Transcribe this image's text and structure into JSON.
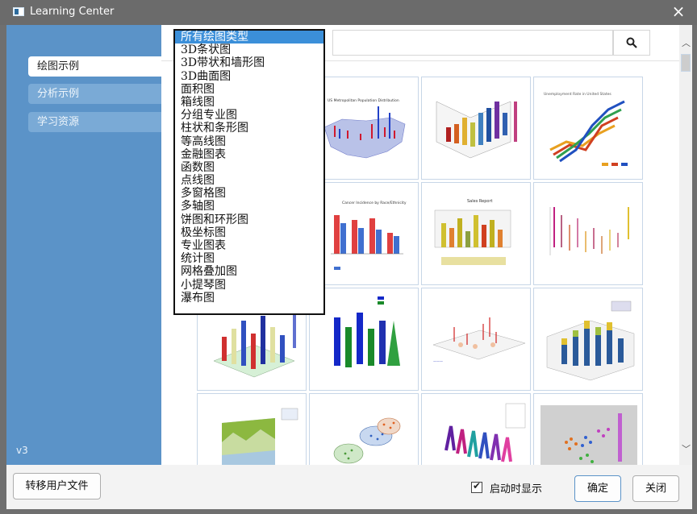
{
  "window": {
    "title": "Learning Center",
    "close_icon": "×"
  },
  "sidebar": {
    "items": [
      {
        "label": "绘图示例",
        "active": true
      },
      {
        "label": "分析示例",
        "active": false
      },
      {
        "label": "学习资源",
        "active": false
      }
    ],
    "version": "v3"
  },
  "search": {
    "value": "",
    "placeholder": ""
  },
  "dropdown": {
    "selected": "所有绘图类型",
    "options": [
      "所有绘图类型",
      "3D条状图",
      "3D带状和墙形图",
      "3D曲面图",
      "面积图",
      "箱线图",
      "分组专业图",
      "柱状和条形图",
      "等高线图",
      "金融图表",
      "函数图",
      "点线图",
      "多窗格图",
      "多轴图",
      "饼图和环形图",
      "极坐标图",
      "专业图表",
      "统计图",
      "网格叠加图",
      "小提琴图",
      "瀑布图"
    ]
  },
  "gallery": {
    "thumbnails": [
      {
        "name": "us-population-map",
        "title": "US Metropolitan Population Distribution"
      },
      {
        "name": "3d-bars-colormap",
        "title": ""
      },
      {
        "name": "unemployment-3d-ribbons",
        "title": "Unemployment Rate in United States"
      },
      {
        "name": "cancer-incidence-bars",
        "title": "Cancer Incidence by Race/Ethnicity"
      },
      {
        "name": "sales-report-3d-bars",
        "title": "Sales Report"
      },
      {
        "name": "3d-scatter-drops",
        "title": ""
      },
      {
        "name": "3d-cylinder-bars",
        "title": ""
      },
      {
        "name": "3d-cone-bars",
        "title": ""
      },
      {
        "name": "3d-waterfall-surface",
        "title": ""
      },
      {
        "name": "3d-stacked-cylinders",
        "title": ""
      },
      {
        "name": "area-wall-plot",
        "title": ""
      },
      {
        "name": "3d-scatter-ellipsoids",
        "title": ""
      },
      {
        "name": "3d-ribbon-waterfall",
        "title": ""
      },
      {
        "name": "3d-scatter-colormap",
        "title": ""
      }
    ]
  },
  "footer": {
    "transfer_button": "转移用户文件",
    "startup_checkbox": {
      "label": "启动时显示",
      "checked": true
    },
    "ok_button": "确定",
    "close_button": "关闭"
  }
}
